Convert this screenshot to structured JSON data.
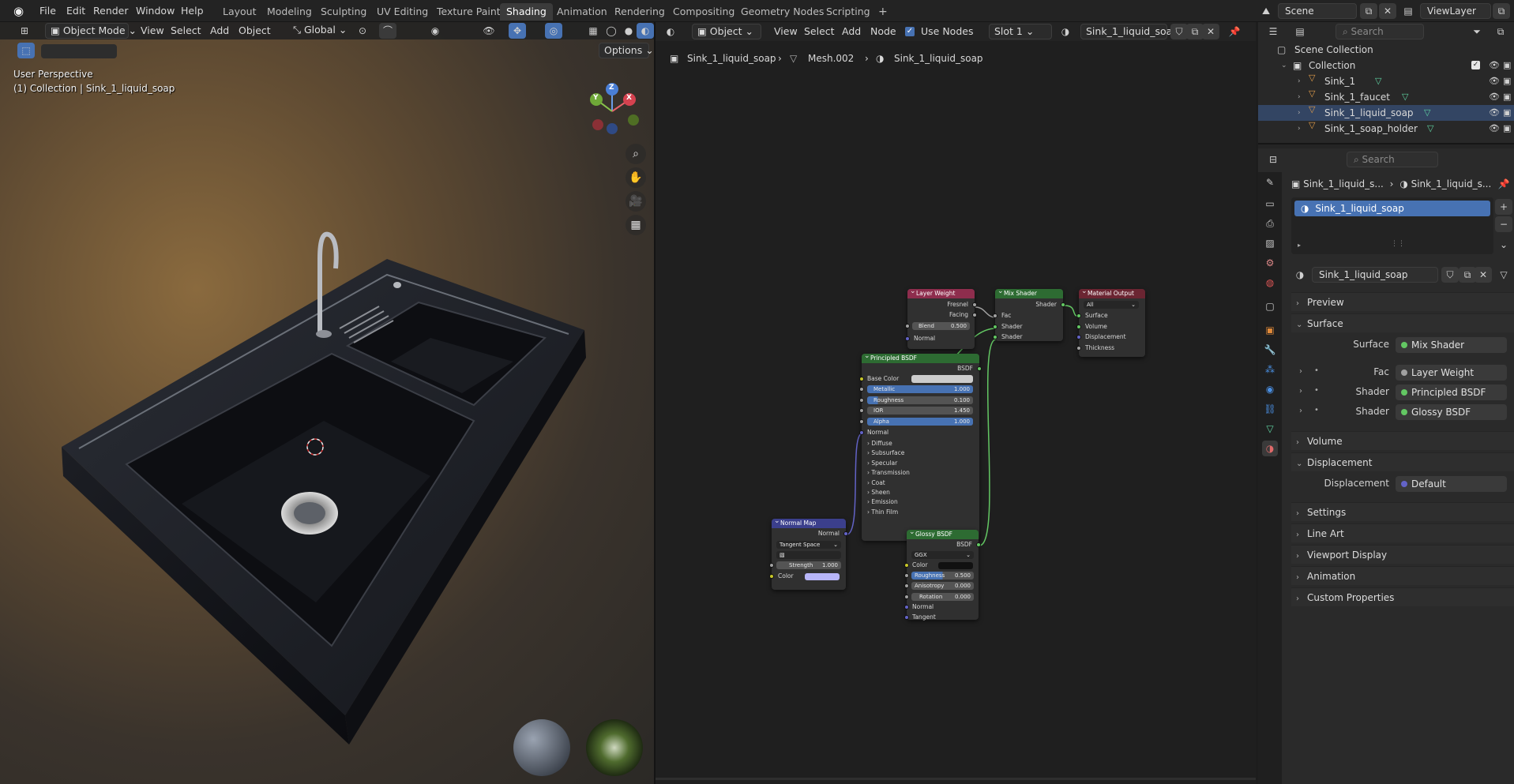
{
  "colors": {
    "accent_blue": "#4772b3",
    "shader_green": "#63c763",
    "node_header_green": "#2d6b32",
    "node_header_red": "#8e2d4d",
    "node_header_blue": "#3b3f8c",
    "node_header_output": "#6b2532",
    "object_orange": "#e09c4a"
  },
  "topbar": {
    "menus": [
      "File",
      "Edit",
      "Render",
      "Window",
      "Help"
    ],
    "workspaces": [
      "Layout",
      "Modeling",
      "Sculpting",
      "UV Editing",
      "Texture Paint",
      "Shading",
      "Animation",
      "Rendering",
      "Compositing",
      "Geometry Nodes",
      "Scripting"
    ],
    "active_workspace": "Shading",
    "add_tab": "+",
    "scene": "Scene",
    "view_layer": "ViewLayer"
  },
  "viewport": {
    "mode": "Object Mode",
    "menus": [
      "View",
      "Select",
      "Add",
      "Object"
    ],
    "orientation": "Global",
    "options": "Options",
    "overlay_view": "User Perspective",
    "overlay_collection": "(1) Collection | Sink_1_liquid_soap",
    "gizmo": {
      "x": "X",
      "y": "Y",
      "z": "Z"
    }
  },
  "node_editor": {
    "object_type": "Object",
    "menus": [
      "View",
      "Select",
      "Add",
      "Node"
    ],
    "use_nodes": "Use Nodes",
    "slot": "Slot 1",
    "material": "Sink_1_liquid_soap",
    "breadcrumb": [
      "Sink_1_liquid_soap",
      "Mesh.002",
      "Sink_1_liquid_soap"
    ],
    "nodes": {
      "layer_weight": {
        "title": "Layer Weight",
        "out1": "Fresnel",
        "out2": "Facing",
        "blend_label": "Blend",
        "blend_value": "0.500",
        "normal": "Normal"
      },
      "mix_shader": {
        "title": "Mix Shader",
        "out": "Shader",
        "fac": "Fac",
        "shader1": "Shader",
        "shader2": "Shader"
      },
      "material_output": {
        "title": "Material Output",
        "target": "All",
        "surface": "Surface",
        "volume": "Volume",
        "displacement": "Displacement",
        "thickness": "Thickness"
      },
      "principled": {
        "title": "Principled BSDF",
        "out": "BSDF",
        "base_color": "Base Color",
        "metallic_label": "Metallic",
        "metallic_value": "1.000",
        "roughness_label": "Roughness",
        "roughness_value": "0.100",
        "ior_label": "IOR",
        "ior_value": "1.450",
        "alpha_label": "Alpha",
        "alpha_value": "1.000",
        "normal": "Normal",
        "sections": [
          "Diffuse",
          "Subsurface",
          "Specular",
          "Transmission",
          "Coat",
          "Sheen",
          "Emission",
          "Thin Film"
        ]
      },
      "normal_map": {
        "title": "Normal Map",
        "out": "Normal",
        "space": "Tangent Space",
        "strength_label": "Strength",
        "strength_value": "1.000",
        "color": "Color"
      },
      "glossy": {
        "title": "Glossy BSDF",
        "out": "BSDF",
        "distribution": "GGX",
        "color": "Color",
        "roughness_label": "Roughness",
        "roughness_value": "0.500",
        "anisotropy_label": "Anisotropy",
        "anisotropy_value": "0.000",
        "rotation_label": "Rotation",
        "rotation_value": "0.000",
        "normal": "Normal",
        "tangent": "Tangent"
      }
    }
  },
  "outliner": {
    "search_placeholder": "Search",
    "scene_collection": "Scene Collection",
    "collection": "Collection",
    "objects": [
      "Sink_1",
      "Sink_1_faucet",
      "Sink_1_liquid_soap",
      "Sink_1_soap_holder"
    ]
  },
  "properties": {
    "search_placeholder": "Search",
    "breadcrumb_object": "Sink_1_liquid_s...",
    "breadcrumb_material": "Sink_1_liquid_s...",
    "slot_item": "Sink_1_liquid_soap",
    "material_name": "Sink_1_liquid_soap",
    "panels": {
      "preview": "Preview",
      "surface": "Surface",
      "surface_label": "Surface",
      "surface_value": "Mix Shader",
      "fac_label": "Fac",
      "fac_value": "Layer Weight",
      "shader1_label": "Shader",
      "shader1_value": "Principled BSDF",
      "shader2_label": "Shader",
      "shader2_value": "Glossy BSDF",
      "volume": "Volume",
      "displacement": "Displacement",
      "disp_label": "Displacement",
      "disp_value": "Default",
      "settings": "Settings",
      "line_art": "Line Art",
      "viewport_display": "Viewport Display",
      "animation": "Animation",
      "custom_properties": "Custom Properties"
    }
  }
}
